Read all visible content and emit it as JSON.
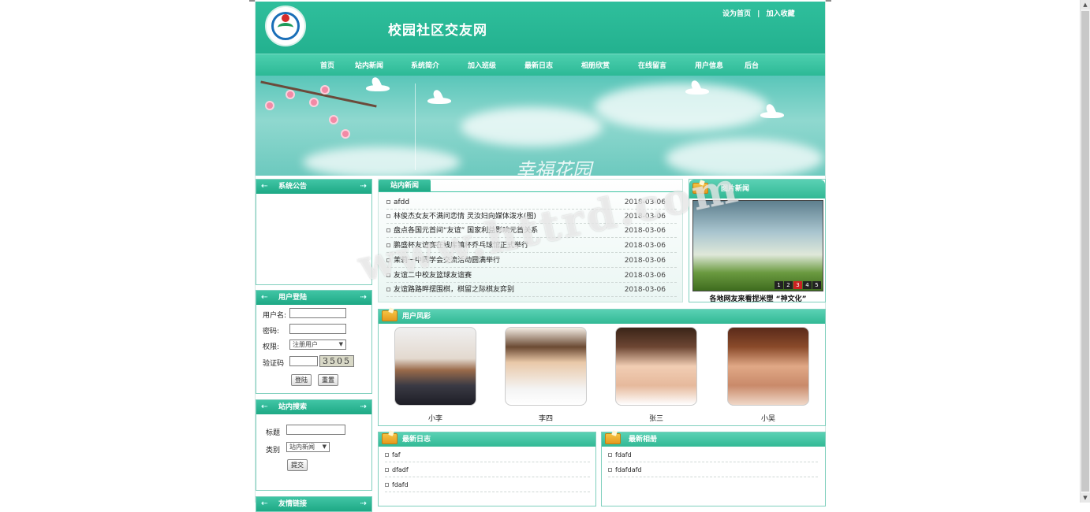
{
  "header": {
    "site_title": "校园社区交友网",
    "set_home": "设为首页",
    "separator": "|",
    "add_favorite": "加入收藏"
  },
  "nav": {
    "items": [
      "首页",
      "站内新闻",
      "系统简介",
      "加入班级",
      "最新日志",
      "相册欣赏",
      "在线留言",
      "用户信息",
      "后台"
    ]
  },
  "banner": {
    "text": "幸福花园"
  },
  "announcement": {
    "title": "系统公告"
  },
  "login": {
    "title": "用户登陆",
    "username_label": "用户名:",
    "password_label": "密码:",
    "role_label": "权限:",
    "role_value": "注册用户",
    "captcha_label": "验证码",
    "captcha_value": "3505",
    "login_button": "登陆",
    "reset_button": "重置"
  },
  "search": {
    "title": "站内搜索",
    "title_label": "标题",
    "category_label": "类别",
    "category_value": "站内新闻",
    "submit_button": "提交"
  },
  "news": {
    "tab": "站内新闻",
    "rows": [
      {
        "title": "afdd",
        "date": "2018-03-06"
      },
      {
        "title": "林俊杰女友不满问恋情 灵汝妇向媒体泼水(图)",
        "date": "2018-03-06"
      },
      {
        "title": "盘点各国元首间“友谊” 国家利益影响元首关系",
        "date": "2018-03-06"
      },
      {
        "title": "鹏盛杯友谊赛在钱库镇杯乔乓球馆正式举行",
        "date": "2018-03-06"
      },
      {
        "title": "茉莉一中同学会交流活动圆满举行",
        "date": "2018-03-06"
      },
      {
        "title": "友谊二中校友篮球友谊赛",
        "date": "2018-03-06"
      },
      {
        "title": "友谊路路畔摆围棋，棋留之际棋友弈别",
        "date": "2018-03-06"
      }
    ]
  },
  "photo_news": {
    "title": "图片新闻",
    "numbers": [
      "1",
      "2",
      "3",
      "4",
      "5"
    ],
    "active": 3,
    "caption": "各地网友来看捏米塑 “神文化”"
  },
  "users": {
    "title": "用户风彩",
    "people": [
      "小李",
      "李四",
      "张三",
      "小吴"
    ]
  },
  "blog": {
    "title": "最新日志",
    "items": [
      "faf",
      "dfadf",
      "fdafd"
    ]
  },
  "album": {
    "title": "最新相册",
    "items": [
      "fdafd",
      "fdafdafd"
    ]
  },
  "bottom_box": {
    "title": "友情链接"
  },
  "watermark": "www.httrd.com",
  "colors": {
    "brand": "#23b18f",
    "border": "#7fcfbd"
  }
}
